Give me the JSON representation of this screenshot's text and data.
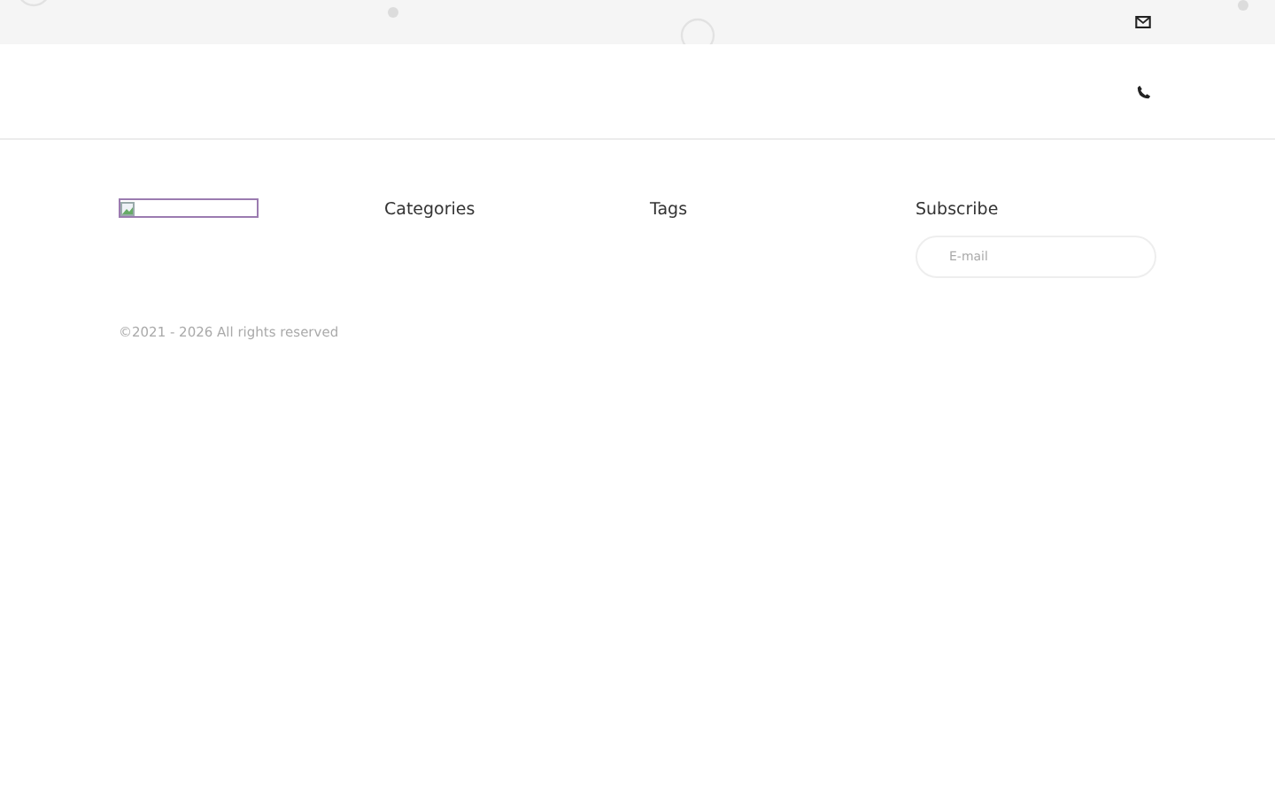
{
  "footer": {
    "columns": [
      {
        "kind": "logo"
      },
      {
        "kind": "heading",
        "title": "Categories"
      },
      {
        "kind": "heading",
        "title": "Tags"
      },
      {
        "kind": "subscribe",
        "title": "Subscribe",
        "placeholder": "E-mail"
      }
    ]
  },
  "copyright": "©2021 - 2026 All rights reserved"
}
